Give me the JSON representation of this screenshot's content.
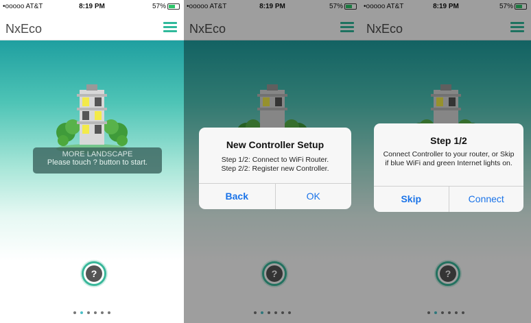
{
  "status": {
    "carrier": "•ooooo AT&T",
    "time": "8:19 PM",
    "battery": "57%"
  },
  "app": {
    "brand": "NxEco"
  },
  "screen1": {
    "toast_title": "MORE LANDSCAPE",
    "toast_message": "Please touch ? button to start."
  },
  "help_button": "?",
  "page_dots": {
    "count": 6,
    "active_index": 1
  },
  "screen2": {
    "alert": {
      "title": "New Controller Setup",
      "line1": "Step 1/2: Connect to WiFi Router.",
      "line2": "Step 2/2: Register new Controller.",
      "left_button": "Back",
      "right_button": "OK"
    }
  },
  "screen3": {
    "alert": {
      "title": "Step 1/2",
      "message": "Connect Controller to your router, or Skip if blue WiFi and green Internet lights on.",
      "left_button": "Skip",
      "right_button": "Connect"
    }
  },
  "colors": {
    "accent": "#2fb99b",
    "link": "#1a73e8",
    "dot_active": "#4cc0c7"
  }
}
